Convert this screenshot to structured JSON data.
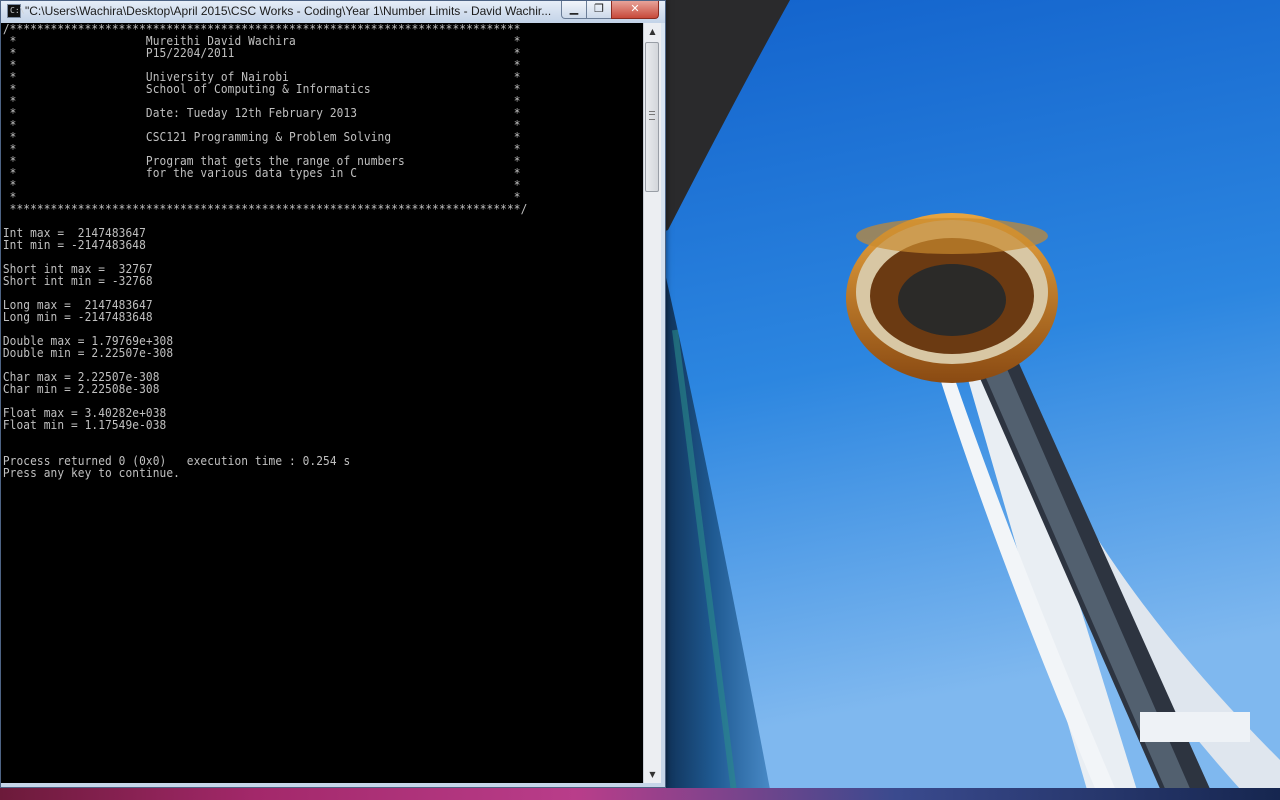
{
  "window": {
    "title": "\"C:\\Users\\Wachira\\Desktop\\April 2015\\CSC Works - Coding\\Year 1\\Number Limits - David Wachir...",
    "icon_label": "C:\\",
    "minimize_icon": "minimize-icon",
    "maximize_icon": "restore-icon",
    "close_icon": "close-icon"
  },
  "buttons": {
    "minimize": "▁",
    "restore": "❐",
    "close": "✕"
  },
  "console": {
    "lines": [
      "/***************************************************************************",
      " *                   Mureithi David Wachira                                *",
      " *                   P15/2204/2011                                         *",
      " *                                                                         *",
      " *                   University of Nairobi                                 *",
      " *                   School of Computing & Informatics                     *",
      " *                                                                         *",
      " *                   Date: Tueday 12th February 2013                       *",
      " *                                                                         *",
      " *                   CSC121 Programming & Problem Solving                  *",
      " *                                                                         *",
      " *                   Program that gets the range of numbers                *",
      " *                   for the various data types in C                       *",
      " *                                                                         *",
      " *                                                                         *",
      " ***************************************************************************/",
      "",
      "Int max =  2147483647",
      "Int min = -2147483648",
      "",
      "Short int max =  32767",
      "Short int min = -32768",
      "",
      "Long max =  2147483647",
      "Long min = -2147483648",
      "",
      "Double max = 1.79769e+308",
      "Double min = 2.22507e-308",
      "",
      "Char max = 2.22507e-308",
      "Char min = 2.22508e-308",
      "",
      "Float max = 3.40282e+038",
      "Float min = 1.17549e-038",
      "",
      "",
      "Process returned 0 (0x0)   execution time : 0.254 s",
      "Press any key to continue."
    ]
  },
  "colors": {
    "console_bg": "#000000",
    "console_fg": "#c0c0c0",
    "sky": "#1a6fd0"
  }
}
